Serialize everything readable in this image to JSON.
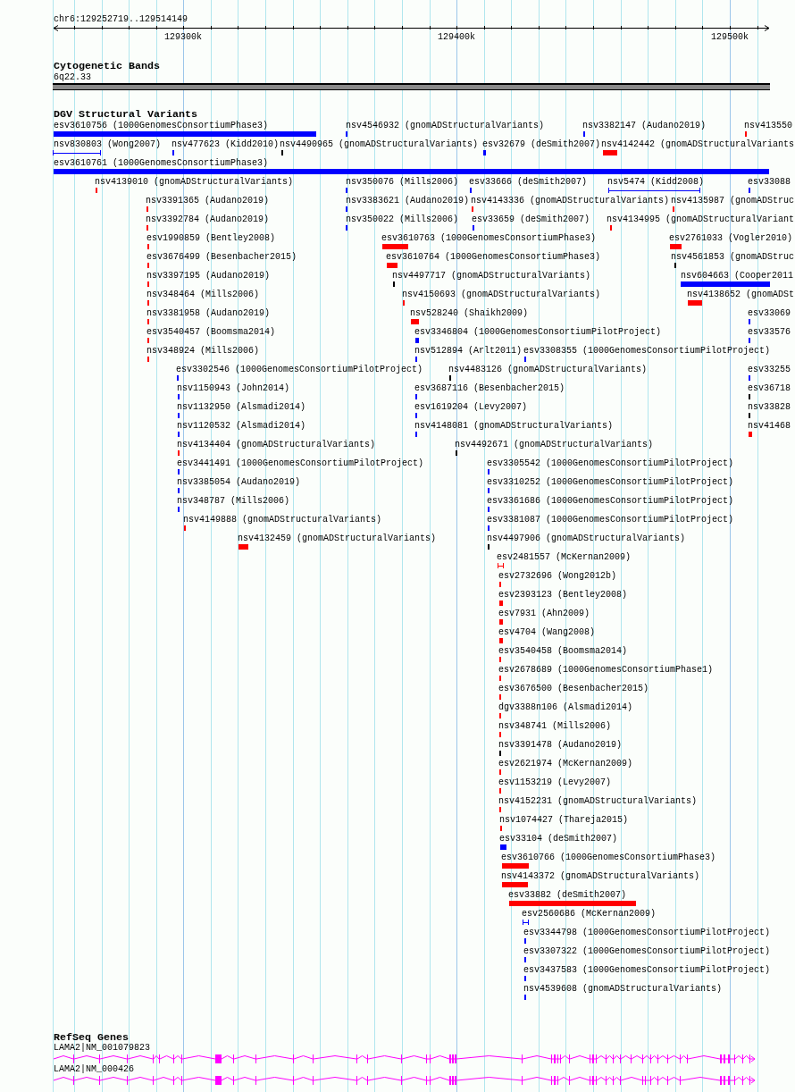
{
  "ruler": {
    "location": "chr6:129252719..129514149",
    "tick_labels": [
      "129300k",
      "129400k",
      "129500k"
    ]
  },
  "tracks": [
    {
      "kind": "cytoband",
      "title": "Cytogenetic Bands",
      "band_label": "6q22.33"
    },
    {
      "kind": "variants",
      "title": "DGV Structural Variants",
      "features": [
        {
          "label": "esv3610756 (1000GenomesConsortiumPhase3)",
          "color": "#0000ff",
          "kind": "bar"
        },
        {
          "label": "nsv4546932 (gnomADStructuralVariants)",
          "color": "#0000ff",
          "kind": "bar"
        },
        {
          "label": "nsv3382147 (Audano2019)",
          "color": "#0000ff",
          "kind": "bar"
        },
        {
          "label": "nsv413550",
          "color": "#ff0000",
          "kind": "bar"
        },
        {
          "label": "nsv830803 (Wong2007)",
          "color": "#0000ff",
          "kind": "range"
        },
        {
          "label": "nsv477623 (Kidd2010)",
          "color": "#0000ff",
          "kind": "bar"
        },
        {
          "label": "nsv4490965 (gnomADStructuralVariants)",
          "color": "#000000",
          "kind": "bar"
        },
        {
          "label": "esv32679 (deSmith2007)",
          "color": "#0000ff",
          "kind": "bar"
        },
        {
          "label": "nsv4142442 (gnomADStructuralVariants",
          "color": "#ff0000",
          "kind": "bar"
        },
        {
          "label": "esv3610761 (1000GenomesConsortiumPhase3)",
          "color": "#0000ff",
          "kind": "bar"
        },
        {
          "label": "nsv4139010 (gnomADStructuralVariants)",
          "color": "#ff0000",
          "kind": "bar"
        },
        {
          "label": "nsv350076 (Mills2006)",
          "color": "#0000ff",
          "kind": "bar"
        },
        {
          "label": "esv33666 (deSmith2007)",
          "color": "#0000ff",
          "kind": "bar"
        },
        {
          "label": "nsv5474 (Kidd2008)",
          "color": "#0000ff",
          "kind": "range"
        },
        {
          "label": "esv33088",
          "color": "#0000ff",
          "kind": "bar"
        },
        {
          "label": "nsv3391365 (Audano2019)",
          "color": "#ff0000",
          "kind": "bar"
        },
        {
          "label": "nsv3383621 (Audano2019)",
          "color": "#0000ff",
          "kind": "bar"
        },
        {
          "label": "nsv4143336 (gnomADStructuralVariants)",
          "color": "#ff0000",
          "kind": "bar"
        },
        {
          "label": "nsv4135987 (gnomADStruc",
          "color": "#ff0000",
          "kind": "bar"
        },
        {
          "label": "nsv3392784 (Audano2019)",
          "color": "#ff0000",
          "kind": "bar"
        },
        {
          "label": "nsv350022 (Mills2006)",
          "color": "#0000ff",
          "kind": "bar"
        },
        {
          "label": "esv33659 (deSmith2007)",
          "color": "#0000ff",
          "kind": "bar"
        },
        {
          "label": "nsv4134995 (gnomADStructuralVariant",
          "color": "#ff0000",
          "kind": "bar"
        },
        {
          "label": "esv1990859 (Bentley2008)",
          "color": "#ff0000",
          "kind": "bar"
        },
        {
          "label": "esv3610763 (1000GenomesConsortiumPhase3)",
          "color": "#ff0000",
          "kind": "bar"
        },
        {
          "label": "esv2761033 (Vogler2010)",
          "color": "#ff0000",
          "kind": "bar"
        },
        {
          "label": "esv3676499 (Besenbacher2015)",
          "color": "#ff0000",
          "kind": "bar"
        },
        {
          "label": "esv3610764 (1000GenomesConsortiumPhase3)",
          "color": "#ff0000",
          "kind": "bar"
        },
        {
          "label": "nsv4561853 (gnomADStruc",
          "color": "#000000",
          "kind": "bar"
        },
        {
          "label": "nsv3397195 (Audano2019)",
          "color": "#ff0000",
          "kind": "bar"
        },
        {
          "label": "nsv4497717 (gnomADStructuralVariants)",
          "color": "#000000",
          "kind": "bar"
        },
        {
          "label": "nsv604663 (Cooper2011",
          "color": "#0000ff",
          "kind": "bar"
        },
        {
          "label": "nsv348464 (Mills2006)",
          "color": "#ff0000",
          "kind": "bar"
        },
        {
          "label": "nsv4150693 (gnomADStructuralVariants)",
          "color": "#ff0000",
          "kind": "bar"
        },
        {
          "label": "nsv4138652 (gnomADSt",
          "color": "#ff0000",
          "kind": "bar"
        },
        {
          "label": "nsv3381958 (Audano2019)",
          "color": "#ff0000",
          "kind": "bar"
        },
        {
          "label": "nsv528240 (Shaikh2009)",
          "color": "#ff0000",
          "kind": "bar"
        },
        {
          "label": "esv33069",
          "color": "#0000ff",
          "kind": "bar"
        },
        {
          "label": "esv3540457 (Boomsma2014)",
          "color": "#ff0000",
          "kind": "bar"
        },
        {
          "label": "esv3346804 (1000GenomesConsortiumPilotProject)",
          "color": "#0000ff",
          "kind": "bar"
        },
        {
          "label": "esv33576",
          "color": "#0000ff",
          "kind": "bar"
        },
        {
          "label": "nsv348924 (Mills2006)",
          "color": "#ff0000",
          "kind": "bar"
        },
        {
          "label": "nsv512894 (Arlt2011)",
          "color": "#0000ff",
          "kind": "bar"
        },
        {
          "label": "esv3308355 (1000GenomesConsortiumPilotProject)",
          "color": "#0000ff",
          "kind": "bar"
        },
        {
          "label": "esv3302546 (1000GenomesConsortiumPilotProject)",
          "color": "#0000ff",
          "kind": "bar"
        },
        {
          "label": "nsv4483126 (gnomADStructuralVariants)",
          "color": "#000000",
          "kind": "bar"
        },
        {
          "label": "esv33255",
          "color": "#0000ff",
          "kind": "bar"
        },
        {
          "label": "nsv1150943 (John2014)",
          "color": "#0000ff",
          "kind": "bar"
        },
        {
          "label": "esv3687116 (Besenbacher2015)",
          "color": "#0000ff",
          "kind": "bar"
        },
        {
          "label": "esv36718",
          "color": "#000000",
          "kind": "bar"
        },
        {
          "label": "nsv1132950 (Alsmadi2014)",
          "color": "#0000ff",
          "kind": "bar"
        },
        {
          "label": "esv1619204 (Levy2007)",
          "color": "#0000ff",
          "kind": "bar"
        },
        {
          "label": "nsv33828",
          "color": "#000000",
          "kind": "bar"
        },
        {
          "label": "nsv1120532 (Alsmadi2014)",
          "color": "#0000ff",
          "kind": "bar"
        },
        {
          "label": "nsv4148081 (gnomADStructuralVariants)",
          "color": "#0000ff",
          "kind": "bar"
        },
        {
          "label": "nsv41468",
          "color": "#ff0000",
          "kind": "bar"
        },
        {
          "label": "nsv4134404 (gnomADStructuralVariants)",
          "color": "#ff0000",
          "kind": "bar"
        },
        {
          "label": "nsv4492671 (gnomADStructuralVariants)",
          "color": "#000000",
          "kind": "bar"
        },
        {
          "label": "esv3441491 (1000GenomesConsortiumPilotProject)",
          "color": "#0000ff",
          "kind": "bar"
        },
        {
          "label": "esv3305542 (1000GenomesConsortiumPilotProject)",
          "color": "#0000ff",
          "kind": "bar"
        },
        {
          "label": "nsv3385054 (Audano2019)",
          "color": "#0000ff",
          "kind": "bar"
        },
        {
          "label": "esv3310252 (1000GenomesConsortiumPilotProject)",
          "color": "#0000ff",
          "kind": "bar"
        },
        {
          "label": "nsv348787 (Mills2006)",
          "color": "#0000ff",
          "kind": "bar"
        },
        {
          "label": "esv3361686 (1000GenomesConsortiumPilotProject)",
          "color": "#0000ff",
          "kind": "bar"
        },
        {
          "label": "nsv4149888 (gnomADStructuralVariants)",
          "color": "#ff0000",
          "kind": "bar"
        },
        {
          "label": "esv3381087 (1000GenomesConsortiumPilotProject)",
          "color": "#0000ff",
          "kind": "bar"
        },
        {
          "label": "nsv4132459 (gnomADStructuralVariants)",
          "color": "#ff0000",
          "kind": "bar"
        },
        {
          "label": "nsv4497906 (gnomADStructuralVariants)",
          "color": "#000000",
          "kind": "bar"
        },
        {
          "label": "esv2481557 (McKernan2009)",
          "color": "#ff0000",
          "kind": "range"
        },
        {
          "label": "esv2732696 (Wong2012b)",
          "color": "#ff0000",
          "kind": "bar"
        },
        {
          "label": "esv2393123 (Bentley2008)",
          "color": "#ff0000",
          "kind": "bar"
        },
        {
          "label": "esv7931 (Ahn2009)",
          "color": "#ff0000",
          "kind": "bar"
        },
        {
          "label": "esv4704 (Wang2008)",
          "color": "#ff0000",
          "kind": "bar"
        },
        {
          "label": "esv3540458 (Boomsma2014)",
          "color": "#ff0000",
          "kind": "bar"
        },
        {
          "label": "esv2678689 (1000GenomesConsortiumPhase1)",
          "color": "#ff0000",
          "kind": "bar"
        },
        {
          "label": "esv3676500 (Besenbacher2015)",
          "color": "#ff0000",
          "kind": "bar"
        },
        {
          "label": "dgv3388n106 (Alsmadi2014)",
          "color": "#ff0000",
          "kind": "bar"
        },
        {
          "label": "nsv348741 (Mills2006)",
          "color": "#ff0000",
          "kind": "bar"
        },
        {
          "label": "nsv3391478 (Audano2019)",
          "color": "#000000",
          "kind": "bar"
        },
        {
          "label": "esv2621974 (McKernan2009)",
          "color": "#ff0000",
          "kind": "bar"
        },
        {
          "label": "esv1153219 (Levy2007)",
          "color": "#ff0000",
          "kind": "bar"
        },
        {
          "label": "nsv4152231 (gnomADStructuralVariants)",
          "color": "#ff0000",
          "kind": "bar"
        },
        {
          "label": "nsv1074427 (Thareja2015)",
          "color": "#ff0000",
          "kind": "bar"
        },
        {
          "label": "esv33104 (deSmith2007)",
          "color": "#0000ff",
          "kind": "bar"
        },
        {
          "label": "esv3610766 (1000GenomesConsortiumPhase3)",
          "color": "#ff0000",
          "kind": "bar"
        },
        {
          "label": "nsv4143372 (gnomADStructuralVariants)",
          "color": "#ff0000",
          "kind": "bar"
        },
        {
          "label": "esv33882 (deSmith2007)",
          "color": "#ff0000",
          "kind": "bar"
        },
        {
          "label": "esv2560686 (McKernan2009)",
          "color": "#0000ff",
          "kind": "range"
        },
        {
          "label": "esv3344798 (1000GenomesConsortiumPilotProject)",
          "color": "#0000ff",
          "kind": "bar"
        },
        {
          "label": "esv3307322 (1000GenomesConsortiumPilotProject)",
          "color": "#0000ff",
          "kind": "bar"
        },
        {
          "label": "esv3437583 (1000GenomesConsortiumPilotProject)",
          "color": "#0000ff",
          "kind": "bar"
        },
        {
          "label": "nsv4539608 (gnomADStructuralVariants)",
          "color": "#0000ff",
          "kind": "bar"
        }
      ]
    },
    {
      "kind": "genes",
      "title": "RefSeq Genes",
      "transcripts": [
        {
          "label": "LAMA2|NM_001079823"
        },
        {
          "label": "LAMA2|NM_000426"
        }
      ]
    }
  ]
}
